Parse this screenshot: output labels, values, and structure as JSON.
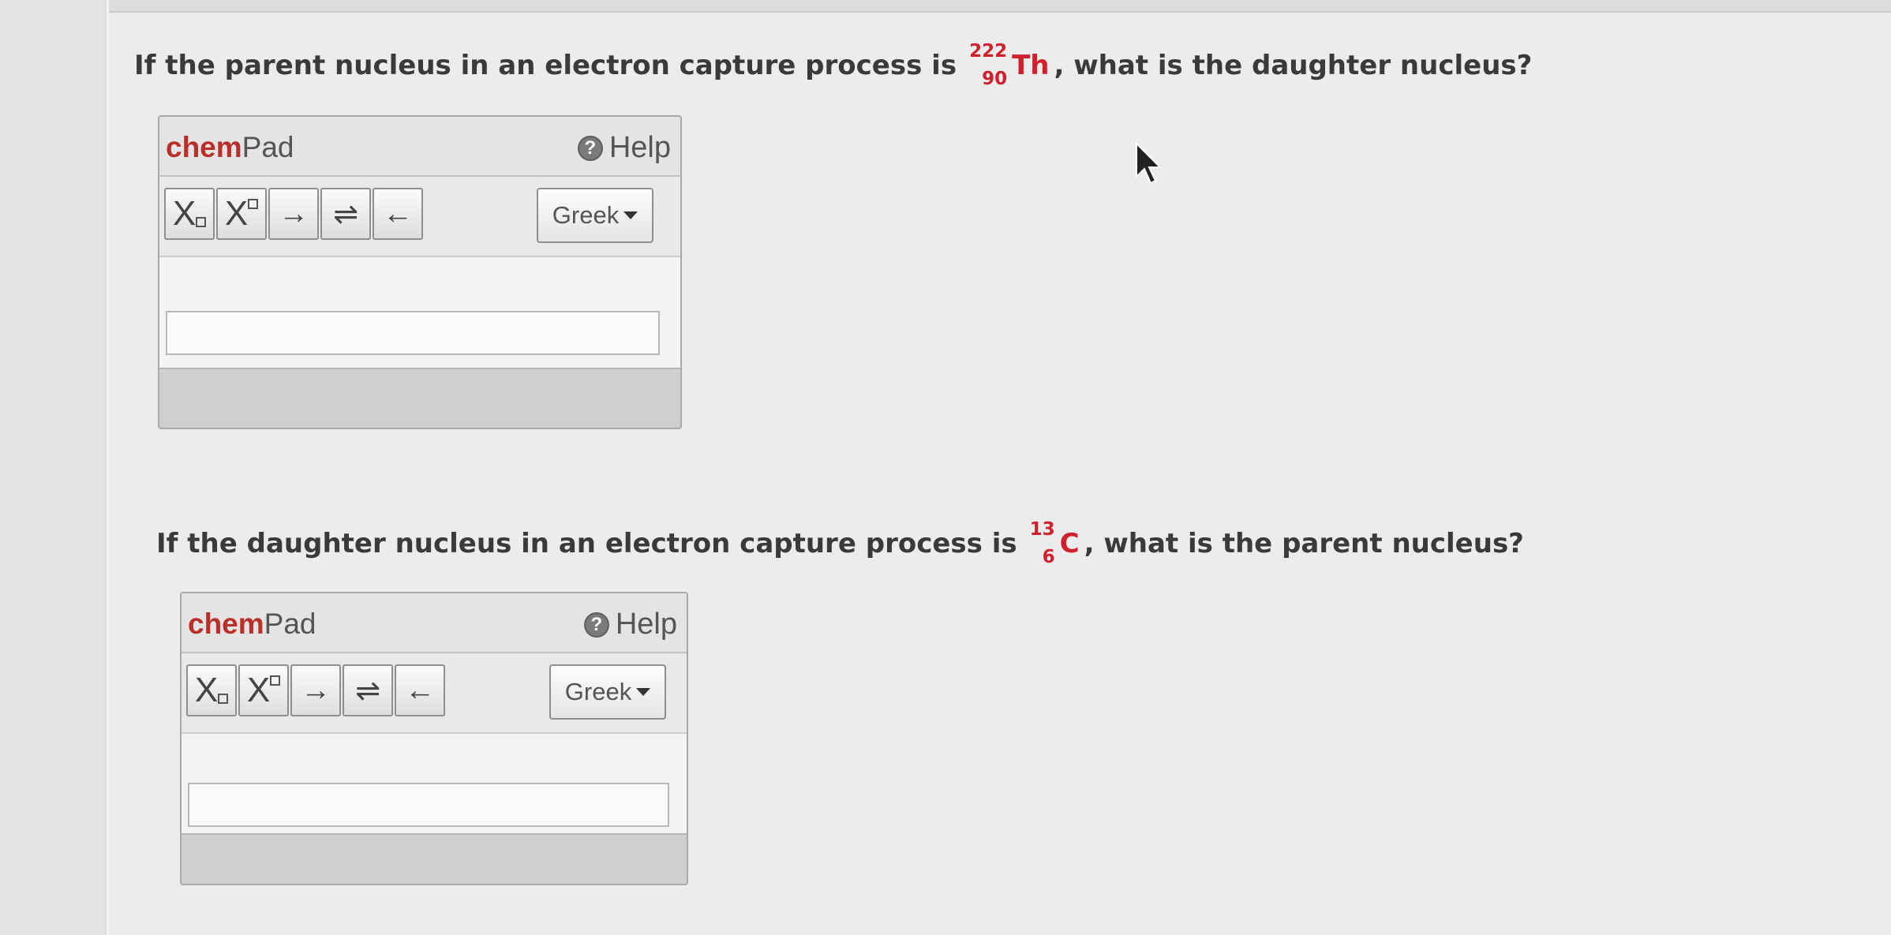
{
  "question1": {
    "before": "If the parent nucleus in an electron capture process is",
    "nuclide": {
      "mass": "222",
      "atomic": "90",
      "symbol": "Th"
    },
    "after": ", what is the daughter nucleus?"
  },
  "question2": {
    "before": "If the daughter nucleus in an electron capture process is",
    "nuclide": {
      "mass": "13",
      "atomic": "6",
      "symbol": "C"
    },
    "after": ", what is the parent nucleus?"
  },
  "chempad": {
    "brand_chem": "chem",
    "brand_pad": "Pad",
    "help_label": "Help",
    "help_icon": "?",
    "toolbar": {
      "x_letter": "X",
      "arrow_right": "→",
      "equilibrium": "⇌",
      "arrow_left": "←",
      "greek_label": "Greek"
    },
    "answer_value": ""
  },
  "colors": {
    "accent_red": "#d0202c",
    "brand_red": "#b9302a"
  },
  "icons": [
    "help-icon",
    "subscript-icon",
    "superscript-icon",
    "right-arrow-icon",
    "equilibrium-arrow-icon",
    "left-arrow-icon",
    "caret-down-icon",
    "mouse-cursor-icon"
  ]
}
